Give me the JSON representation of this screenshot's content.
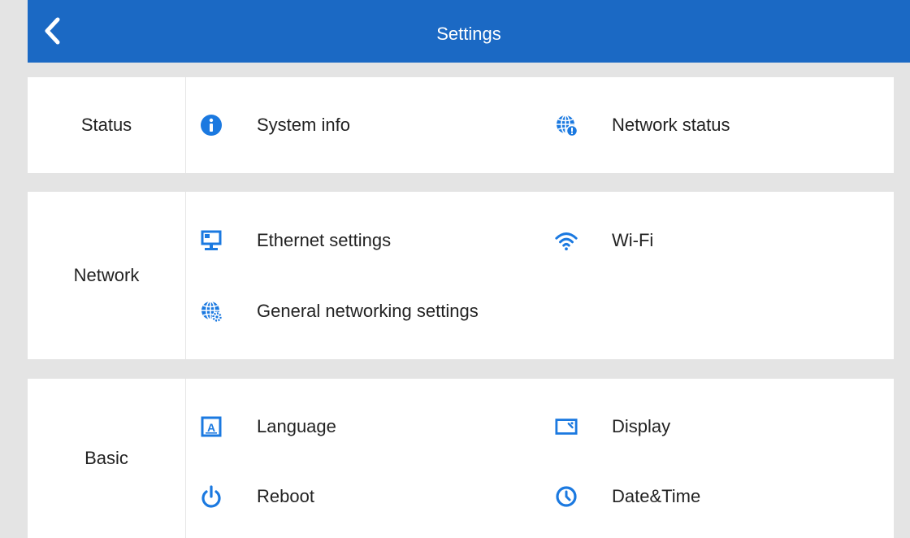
{
  "header": {
    "title": "Settings",
    "back_icon": "chevron-left-icon"
  },
  "colors": {
    "header": "#1b69c4",
    "icon": "#1b79e0",
    "background": "#e4e4e4",
    "card": "#ffffff"
  },
  "sections": {
    "status": {
      "label": "Status",
      "items": [
        {
          "label": "System info",
          "icon": "info-icon"
        },
        {
          "label": "Network status",
          "icon": "globe-alert-icon"
        }
      ]
    },
    "network": {
      "label": "Network",
      "items": [
        {
          "label": "Ethernet settings",
          "icon": "ethernet-icon"
        },
        {
          "label": "Wi-Fi",
          "icon": "wifi-icon"
        },
        {
          "label": "General networking settings",
          "icon": "globe-gear-icon"
        }
      ]
    },
    "basic": {
      "label": "Basic",
      "items": [
        {
          "label": "Language",
          "icon": "language-icon"
        },
        {
          "label": "Display",
          "icon": "display-icon"
        },
        {
          "label": "Reboot",
          "icon": "power-icon"
        },
        {
          "label": "Date&Time",
          "icon": "clock-icon"
        }
      ]
    }
  }
}
